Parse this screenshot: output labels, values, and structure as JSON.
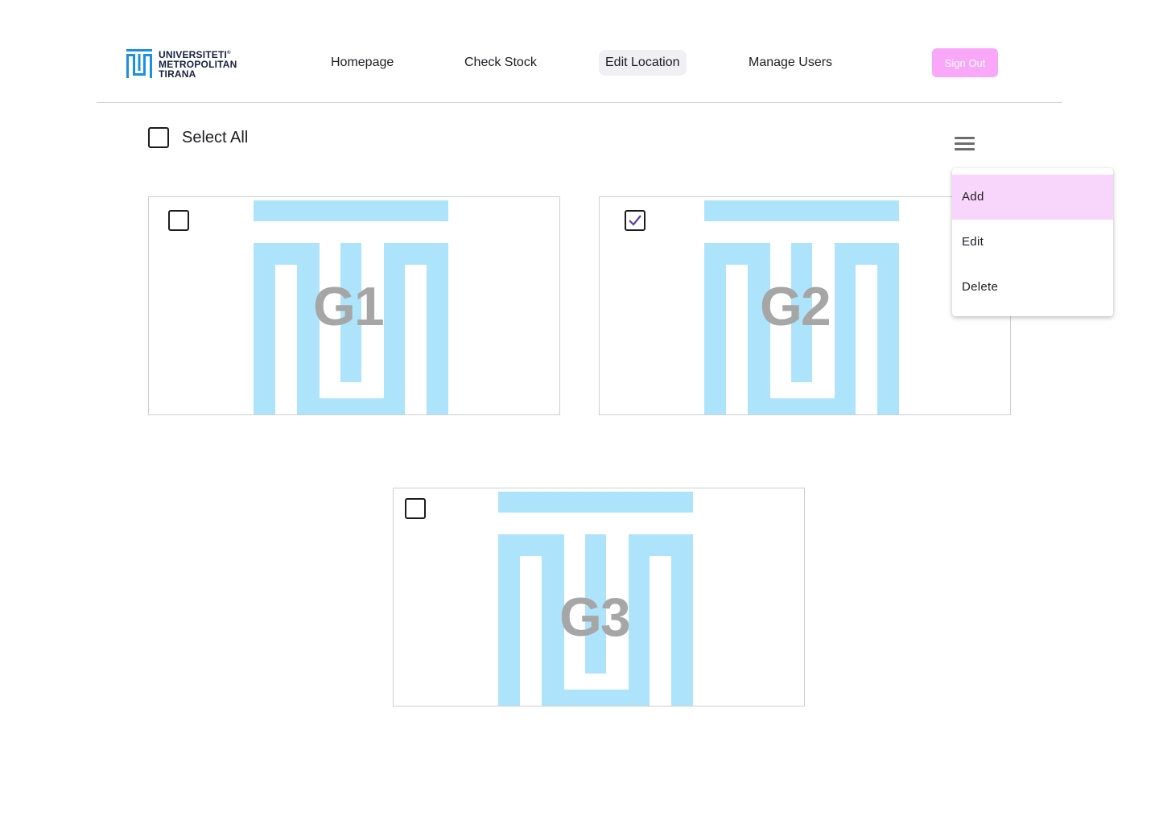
{
  "header": {
    "logo_lines": [
      "UNIVERSITETI",
      "METROPOLITAN",
      "TIRANA"
    ],
    "logo_registered": "®",
    "nav": [
      {
        "label": "Homepage",
        "active": false
      },
      {
        "label": "Check Stock",
        "active": false
      },
      {
        "label": "Edit Location",
        "active": true
      },
      {
        "label": "Manage Users",
        "active": false
      }
    ],
    "signout_label": "Sign Out"
  },
  "toolbar": {
    "select_all_label": "Select All",
    "select_all_checked": false,
    "menu_icon": "hamburger-menu-icon"
  },
  "cards": [
    {
      "label": "G1",
      "checked": false
    },
    {
      "label": "G2",
      "checked": true
    },
    {
      "label": "G3",
      "checked": false
    }
  ],
  "menu": {
    "items": [
      {
        "label": "Add",
        "highlighted": true
      },
      {
        "label": "Edit",
        "highlighted": false
      },
      {
        "label": "Delete",
        "highlighted": false
      }
    ]
  },
  "colors": {
    "brand_blue": "#1b8fe0",
    "emblem_light_blue": "#aee4fb",
    "signout_pink": "#f9a8f9",
    "menu_highlight": "#f8d6fb",
    "checkmark_purple": "#5b3ea8"
  }
}
